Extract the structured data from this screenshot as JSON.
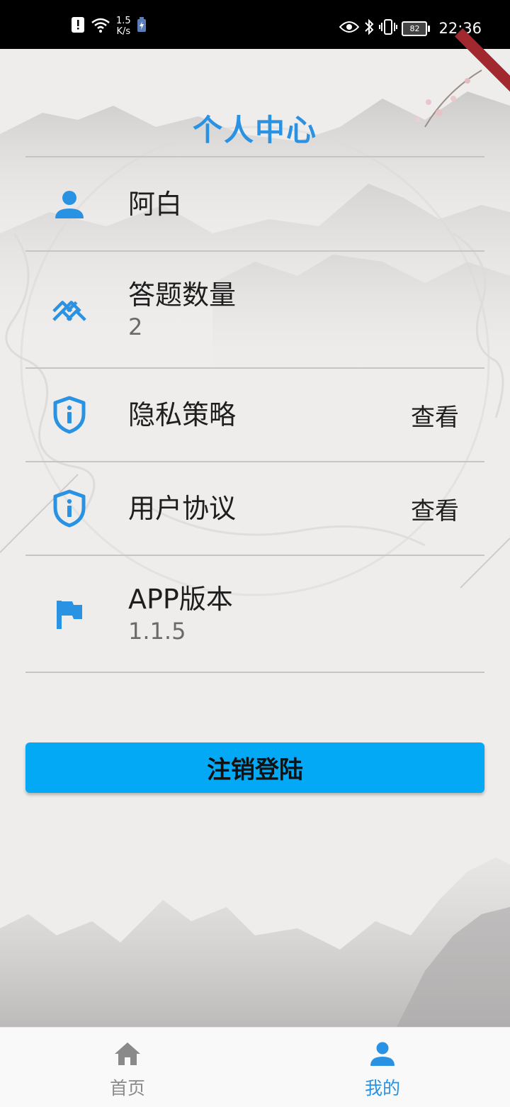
{
  "status_bar": {
    "net_speed_value": "1.5",
    "net_speed_unit": "K/s",
    "battery_level": "82",
    "time": "22:36"
  },
  "page": {
    "title": "个人中心"
  },
  "profile": {
    "username": "阿白",
    "answer_count_label": "答题数量",
    "answer_count_value": "2",
    "privacy_label": "隐私策略",
    "privacy_action": "查看",
    "agreement_label": "用户协议",
    "agreement_action": "查看",
    "version_label": "APP版本",
    "version_value": "1.1.5"
  },
  "logout_button_label": "注销登陆",
  "bottom_nav": {
    "items": [
      {
        "label": "首页",
        "icon": "home-icon",
        "active": false
      },
      {
        "label": "我的",
        "icon": "person-icon",
        "active": true
      }
    ]
  },
  "colors": {
    "accent": "#2a92e2",
    "button": "#03a9f4",
    "inactive": "#8a8a8a"
  }
}
